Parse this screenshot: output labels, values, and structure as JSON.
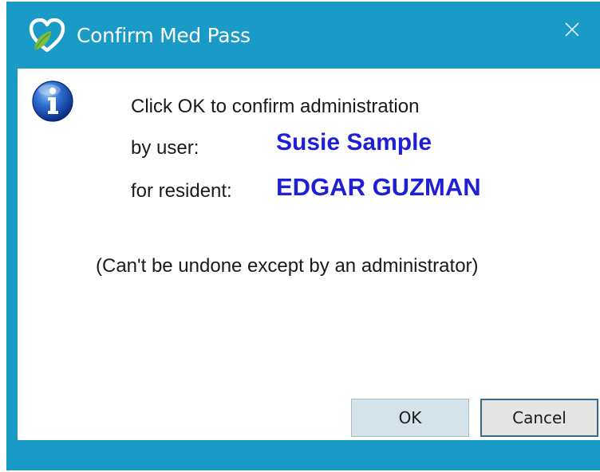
{
  "window": {
    "title": "Confirm Med Pass",
    "frame_color": "#1a9ac7",
    "app_icon": "heart-leaf-icon",
    "close_icon": "close-icon"
  },
  "message": {
    "icon": "info-icon",
    "line1": "Click OK to confirm administration",
    "user_label": "by user:",
    "user_value": "Susie Sample",
    "resident_label": "for resident:",
    "resident_value": "EDGAR GUZMAN",
    "note": "(Can't be undone except by an administrator)",
    "highlight_color": "#1f1fd6"
  },
  "buttons": {
    "ok_label": "OK",
    "cancel_label": "Cancel"
  }
}
